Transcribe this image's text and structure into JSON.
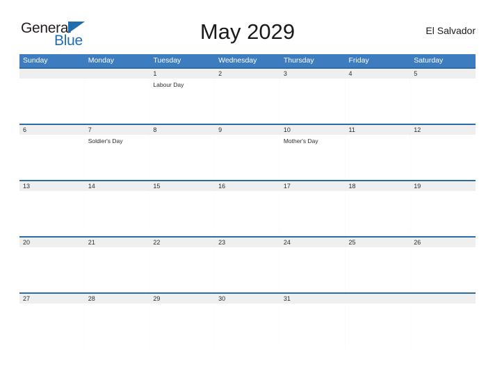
{
  "brand": {
    "name_part1": "General",
    "name_part2": "Blue",
    "triangle_color": "#1f6cb0"
  },
  "header": {
    "title": "May 2029",
    "region": "El Salvador"
  },
  "theme": {
    "header_blue": "#3c7cbf",
    "row_rule_blue": "#2b6ca8",
    "date_band_gray": "#efefef",
    "text_dark": "#2b2b2b"
  },
  "weekdays": [
    "Sunday",
    "Monday",
    "Tuesday",
    "Wednesday",
    "Thursday",
    "Friday",
    "Saturday"
  ],
  "weeks": [
    {
      "days": [
        {
          "date": "",
          "events": []
        },
        {
          "date": "",
          "events": []
        },
        {
          "date": "1",
          "events": [
            "Labour Day"
          ]
        },
        {
          "date": "2",
          "events": []
        },
        {
          "date": "3",
          "events": []
        },
        {
          "date": "4",
          "events": []
        },
        {
          "date": "5",
          "events": []
        }
      ]
    },
    {
      "days": [
        {
          "date": "6",
          "events": []
        },
        {
          "date": "7",
          "events": [
            "Soldier's Day"
          ]
        },
        {
          "date": "8",
          "events": []
        },
        {
          "date": "9",
          "events": []
        },
        {
          "date": "10",
          "events": [
            "Mother's Day"
          ]
        },
        {
          "date": "11",
          "events": []
        },
        {
          "date": "12",
          "events": []
        }
      ]
    },
    {
      "days": [
        {
          "date": "13",
          "events": []
        },
        {
          "date": "14",
          "events": []
        },
        {
          "date": "15",
          "events": []
        },
        {
          "date": "16",
          "events": []
        },
        {
          "date": "17",
          "events": []
        },
        {
          "date": "18",
          "events": []
        },
        {
          "date": "19",
          "events": []
        }
      ]
    },
    {
      "days": [
        {
          "date": "20",
          "events": []
        },
        {
          "date": "21",
          "events": []
        },
        {
          "date": "22",
          "events": []
        },
        {
          "date": "23",
          "events": []
        },
        {
          "date": "24",
          "events": []
        },
        {
          "date": "25",
          "events": []
        },
        {
          "date": "26",
          "events": []
        }
      ]
    },
    {
      "days": [
        {
          "date": "27",
          "events": []
        },
        {
          "date": "28",
          "events": []
        },
        {
          "date": "29",
          "events": []
        },
        {
          "date": "30",
          "events": []
        },
        {
          "date": "31",
          "events": []
        },
        {
          "date": "",
          "events": []
        },
        {
          "date": "",
          "events": []
        }
      ]
    }
  ]
}
